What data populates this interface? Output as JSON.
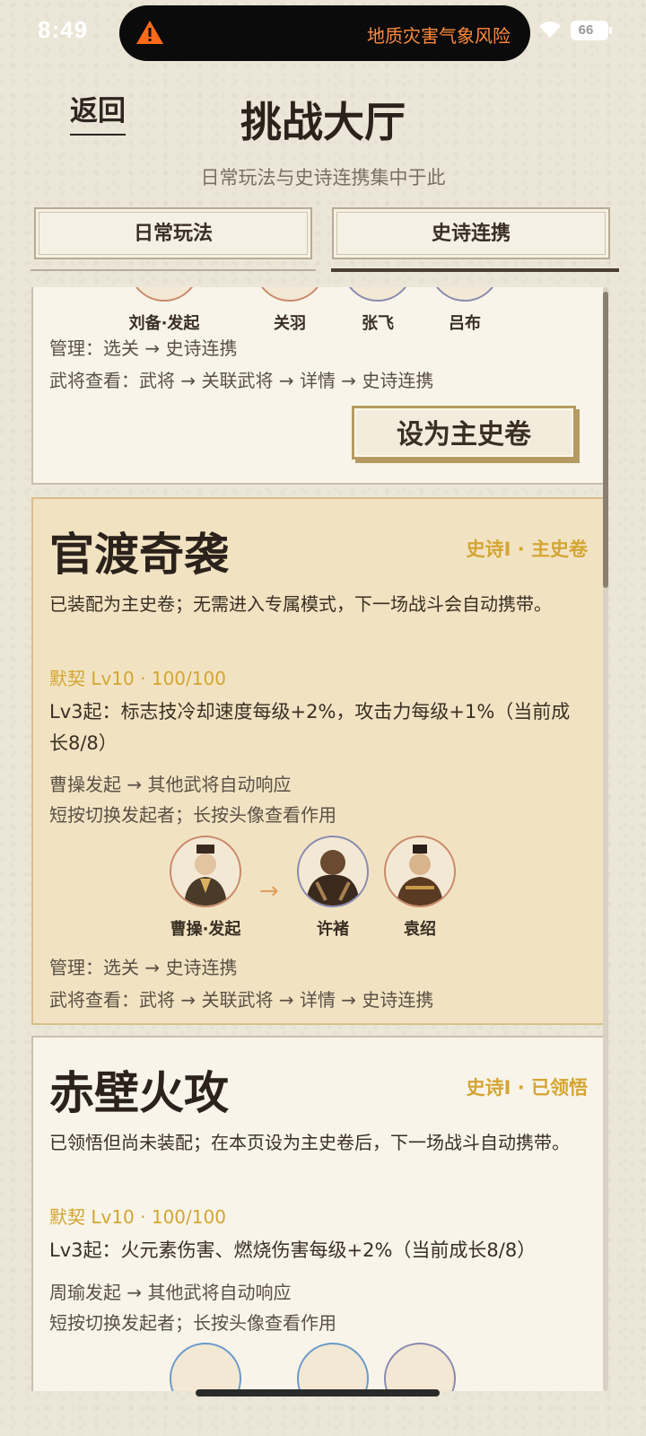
{
  "status_bar": {
    "time": "8:49",
    "alert_text": "地质灾害气象风险",
    "battery": "66"
  },
  "header": {
    "back_label": "返回",
    "title": "挑战大厅",
    "subtitle": "日常玩法与史诗连携集中于此"
  },
  "tabs": [
    {
      "label": "日常玩法",
      "selected": false
    },
    {
      "label": "史诗连携",
      "selected": true
    }
  ],
  "cards": [
    {
      "avatars": [
        {
          "name": "刘备·发起"
        },
        {
          "name": "关羽"
        },
        {
          "name": "张飞"
        },
        {
          "name": "吕布"
        }
      ],
      "nav_manage": "管理：选关 → 史诗连携",
      "nav_view": "武将查看：武将 → 关联武将 → 详情 → 史诗连携",
      "button_label": "设为主史卷"
    },
    {
      "title": "官渡奇袭",
      "tag": "史诗I · 主史卷",
      "description": "已装配为主史卷；无需进入专属模式，下一场战斗会自动携带。",
      "bond": "默契 Lv10 · 100/100",
      "bonus": "Lv3起：标志技冷却速度每级+2%，攻击力每级+1%（当前成长8/8）",
      "trigger": "曹操发起 → 其他武将自动响应",
      "hint": "短按切换发起者；长按头像查看作用",
      "avatars": [
        {
          "name": "曹操·发起"
        },
        {
          "name": "许褚"
        },
        {
          "name": "袁绍"
        }
      ],
      "arrow": "→",
      "nav_manage": "管理：选关 → 史诗连携",
      "nav_view": "武将查看：武将 → 关联武将 → 详情 → 史诗连携"
    },
    {
      "title": "赤壁火攻",
      "tag": "史诗I · 已领悟",
      "description": "已领悟但尚未装配；在本页设为主史卷后，下一场战斗自动携带。",
      "bond": "默契 Lv10 · 100/100",
      "bonus": "Lv3起：火元素伤害、燃烧伤害每级+2%（当前成长8/8）",
      "trigger": "周瑜发起 → 其他武将自动响应",
      "hint": "短按切换发起者；长按头像查看作用"
    }
  ],
  "colors": {
    "background": "#ece6d8",
    "accent_gold": "#d4a534",
    "active_card": "#f1e3c2",
    "alert_orange": "#ff8a3c"
  }
}
